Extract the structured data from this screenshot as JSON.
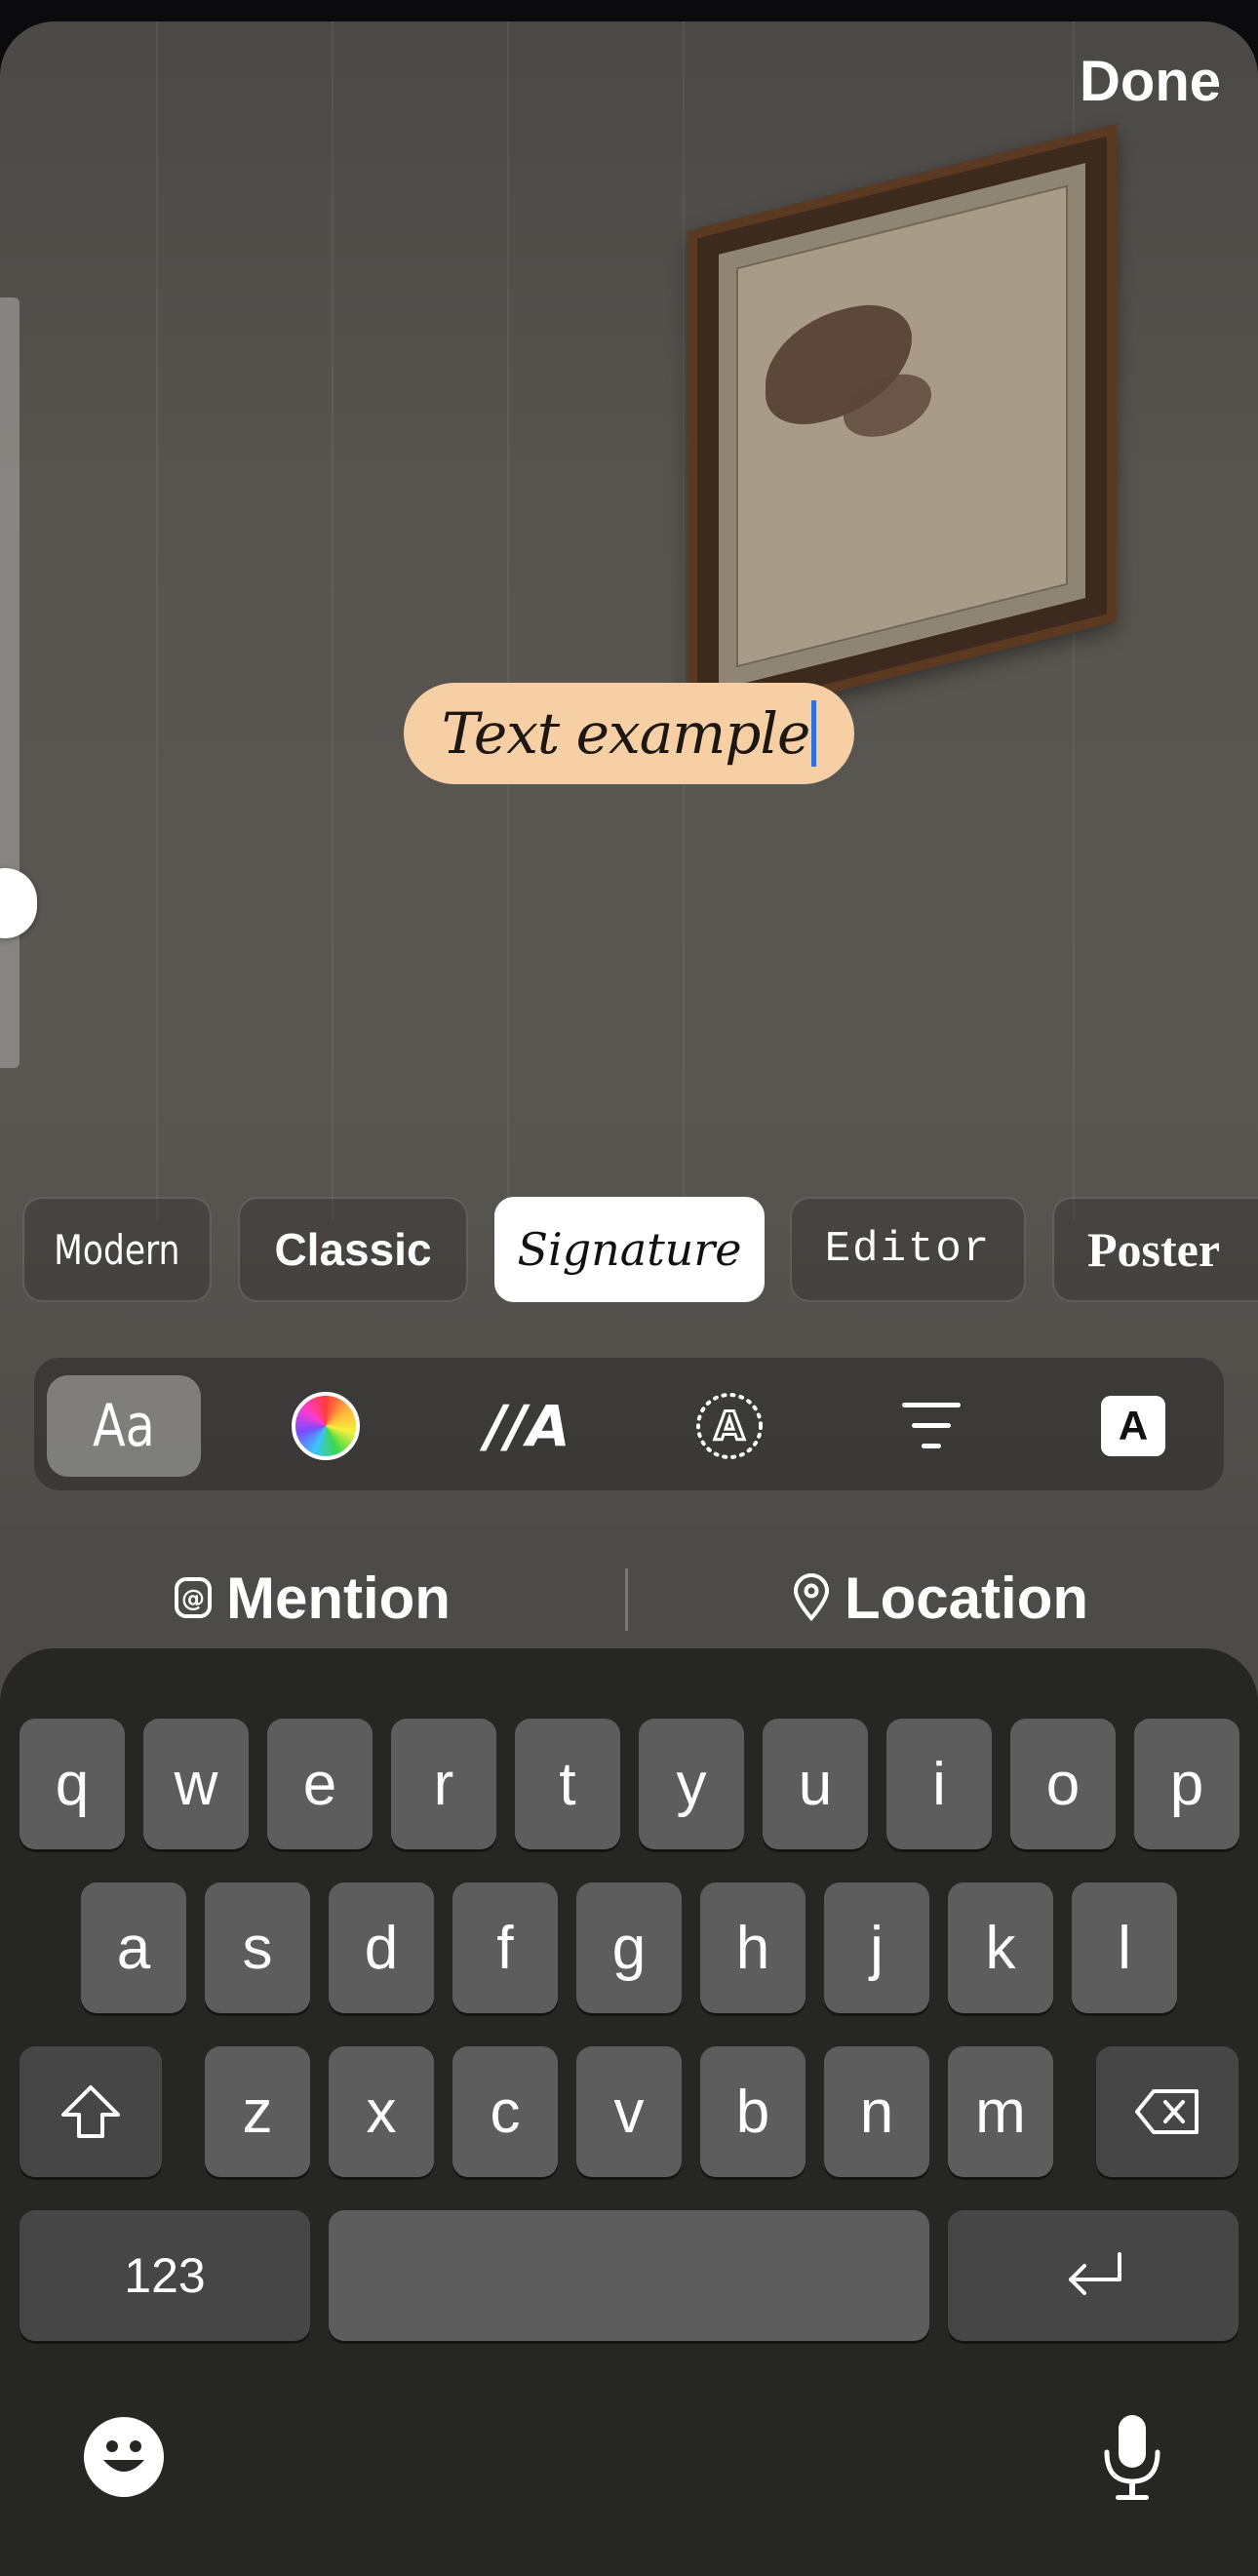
{
  "header": {
    "done_label": "Done"
  },
  "editor": {
    "text": "Text example"
  },
  "font_styles": [
    {
      "label": "Modern",
      "selected": false
    },
    {
      "label": "Classic",
      "selected": false
    },
    {
      "label": "Signature",
      "selected": true
    },
    {
      "label": "Editor",
      "selected": false
    },
    {
      "label": "Poster",
      "selected": false
    }
  ],
  "toolbar": {
    "font_label": "Aa",
    "animation_label": "//A",
    "background_label": "A",
    "icons": [
      "font-icon",
      "color-wheel-icon",
      "animation-icon",
      "text-effect-icon",
      "align-icon",
      "background-icon"
    ]
  },
  "mention_bar": {
    "mention_label": "Mention",
    "location_label": "Location"
  },
  "keyboard": {
    "row1": [
      "q",
      "w",
      "e",
      "r",
      "t",
      "y",
      "u",
      "i",
      "o",
      "p"
    ],
    "row2": [
      "a",
      "s",
      "d",
      "f",
      "g",
      "h",
      "j",
      "k",
      "l"
    ],
    "row3": [
      "z",
      "x",
      "c",
      "v",
      "b",
      "n",
      "m"
    ],
    "numbers_label": "123"
  },
  "colors": {
    "bubble": "#f6cfa4",
    "caret": "#2f6fe4",
    "key": "#5d5d5d",
    "keyboard_bg": "#262625"
  }
}
